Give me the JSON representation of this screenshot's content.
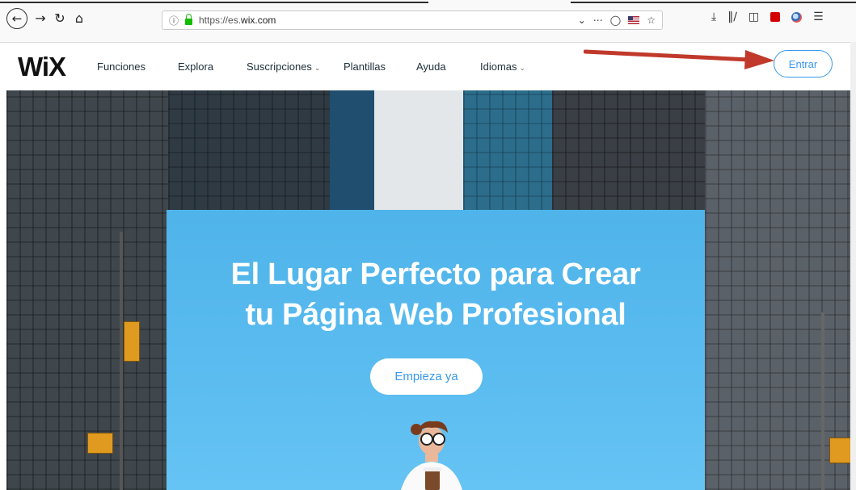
{
  "browser": {
    "url_prefix": "https://es.",
    "url_domain": "wix.com"
  },
  "nav": {
    "logo": "WiX",
    "items": [
      {
        "label": "Funciones",
        "dropdown": false
      },
      {
        "label": "Explora",
        "dropdown": false
      },
      {
        "label": "Suscripciones",
        "dropdown": true
      },
      {
        "label": "Plantillas",
        "dropdown": false
      },
      {
        "label": "Ayuda",
        "dropdown": false
      },
      {
        "label": "Idiomas",
        "dropdown": true
      }
    ],
    "login_label": "Entrar"
  },
  "hero": {
    "headline_line1": "El Lugar Perfecto para Crear",
    "headline_line2": "tu Página Web Profesional",
    "cta_label": "Empieza ya"
  },
  "colors": {
    "accent": "#3899ec",
    "panel": "#5bbcf0",
    "arrow": "#c0392b"
  }
}
